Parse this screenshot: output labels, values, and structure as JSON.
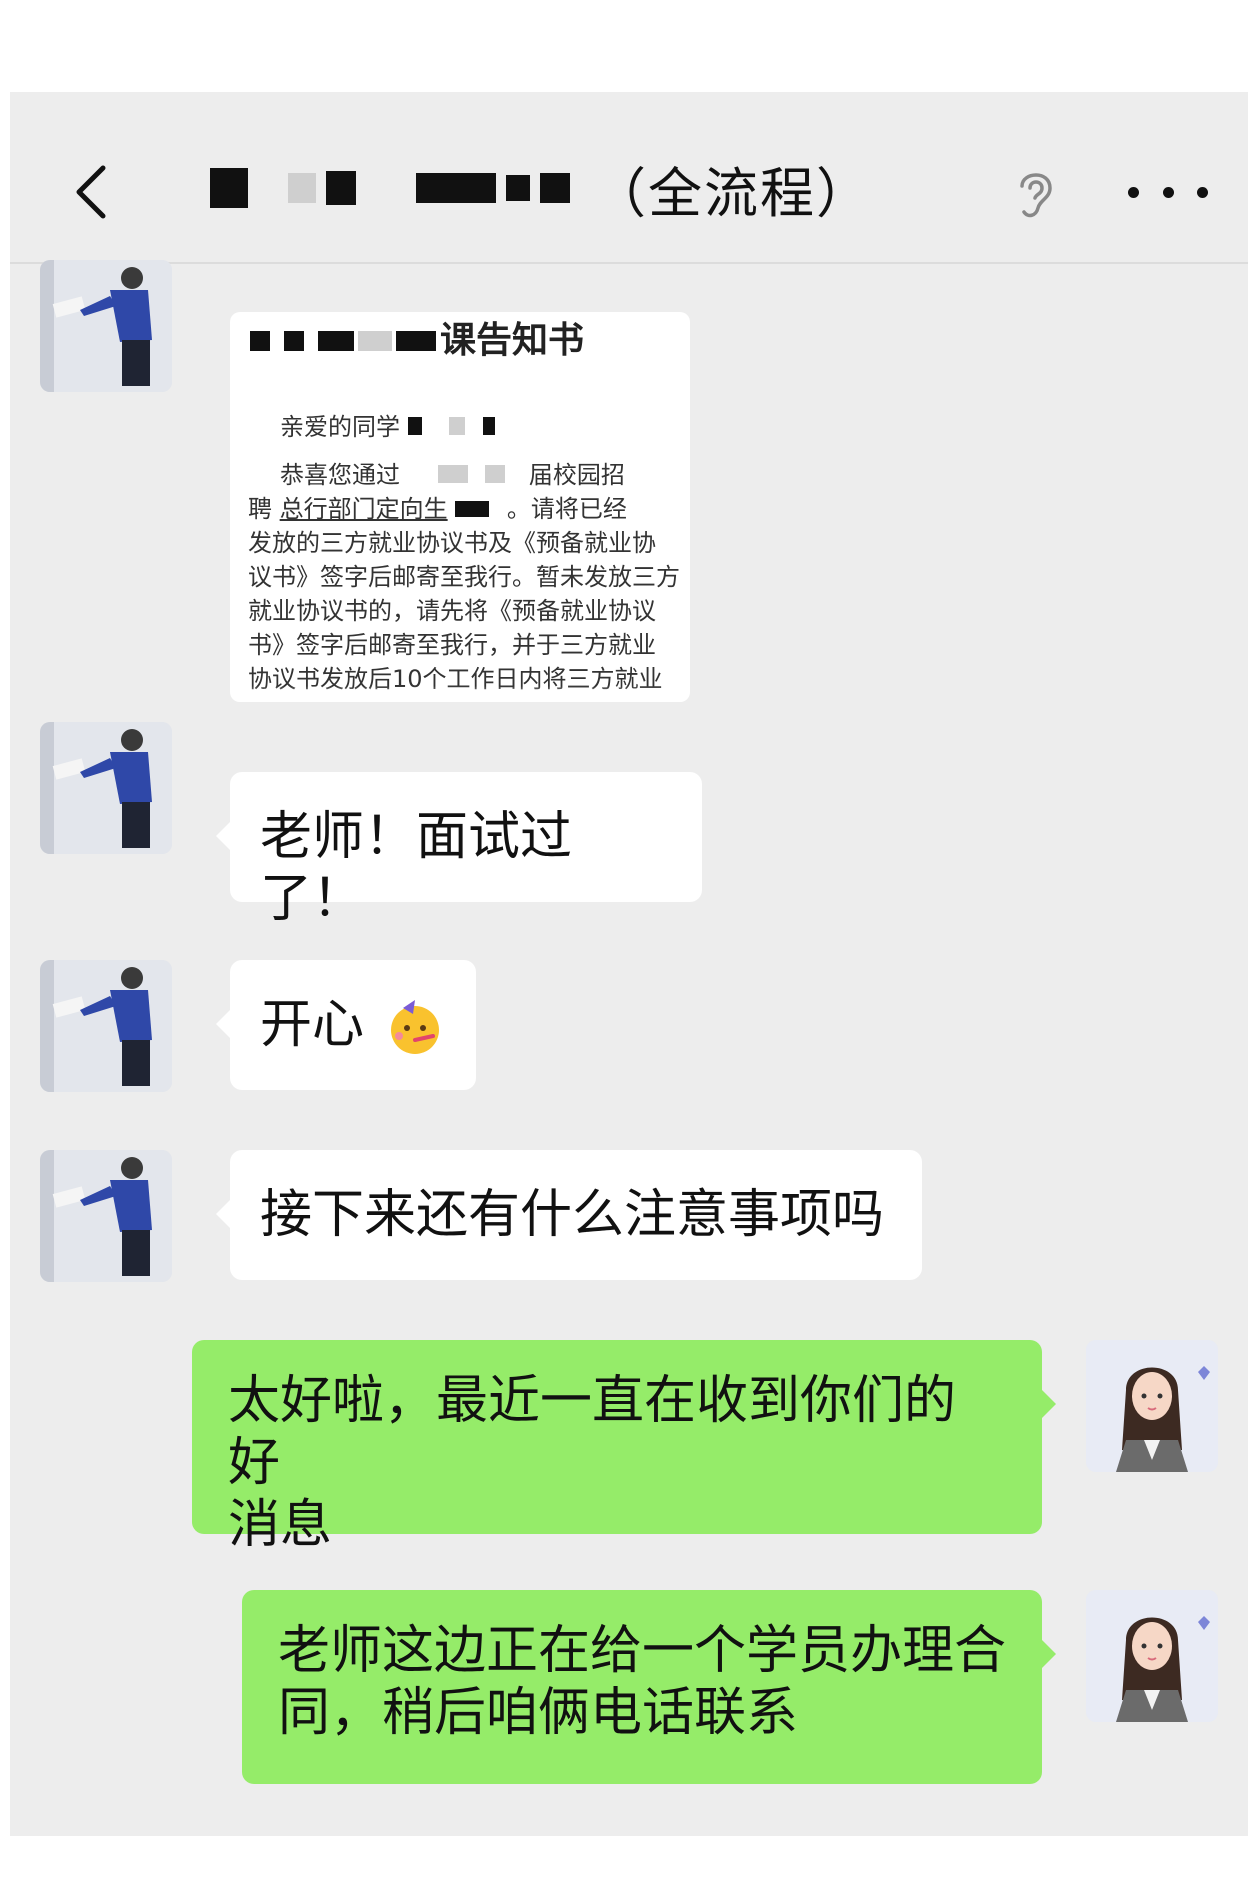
{
  "header": {
    "title_suffix": "（全流程）",
    "back_icon": "chevron-left-icon",
    "voice_icon": "ear-icon",
    "more_icon": "more-dots-icon"
  },
  "messages": [
    {
      "side": "left",
      "type": "document",
      "doc": {
        "title_suffix": "课告知书",
        "line1": "亲爱的同学",
        "line2a": "恭喜您通过",
        "line2b": "届校园招",
        "line3a": "聘",
        "line3b": "总行部门定向生",
        "line3c": "。请将已经",
        "line4": "发放的三方就业协议书及《预备就业协",
        "line5": "议书》签字后邮寄至我行。暂未发放三方",
        "line6": "就业协议书的，请先将《预备就业协议",
        "line7": "书》签字后邮寄至我行，并于三方就业",
        "line8": "协议书发放后10个工作日内将三方就业"
      }
    },
    {
      "side": "left",
      "type": "text",
      "text": "老师！面试过了！"
    },
    {
      "side": "left",
      "type": "text",
      "text": "开心",
      "emoji": "partying-face-icon"
    },
    {
      "side": "left",
      "type": "text",
      "text": "接下来还有什么注意事项吗"
    },
    {
      "side": "right",
      "type": "text",
      "line1": "太好啦，最近一直在收到你们的好",
      "line2": "消息"
    },
    {
      "side": "right",
      "type": "text",
      "line1": "老师这边正在给一个学员办理合",
      "line2": "同，稍后咱俩电话联系"
    }
  ],
  "colors": {
    "background": "#ededed",
    "bubble_white": "#ffffff",
    "bubble_green": "#95ec69"
  }
}
